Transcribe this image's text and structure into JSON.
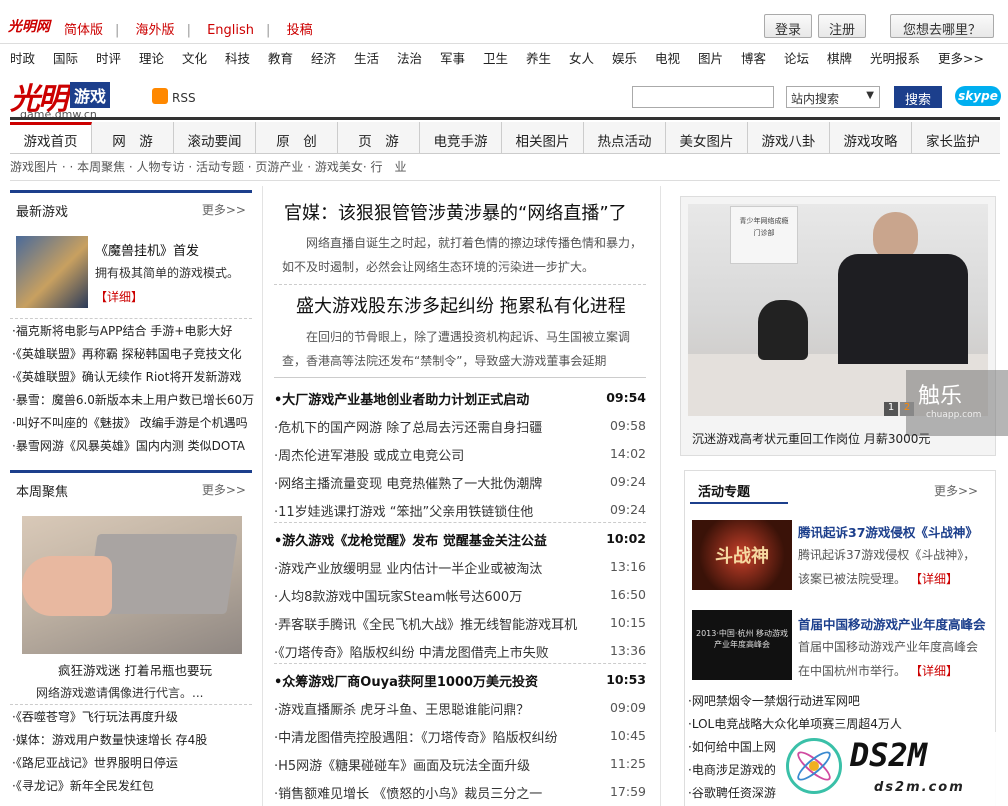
{
  "top": {
    "logo": "光明网",
    "links": [
      "简体版",
      "海外版",
      "English",
      "投稿"
    ],
    "login": "登录",
    "register": "注册",
    "where": "您想去哪里？"
  },
  "nav": [
    "时政",
    "国际",
    "时评",
    "理论",
    "文化",
    "科技",
    "教育",
    "经济",
    "生活",
    "法治",
    "军事",
    "卫生",
    "养生",
    "女人",
    "娱乐",
    "电视",
    "图片",
    "博客",
    "论坛",
    "棋牌",
    "光明报系",
    "更多>>"
  ],
  "brand": {
    "mark": "光明",
    "box": "游戏",
    "url": "game.gmw.cn",
    "rss": "RSS"
  },
  "search": {
    "select": "站内搜索",
    "button": "搜索",
    "skype": "skype"
  },
  "channels": [
    "游戏首页",
    "网　游",
    "滚动要闻",
    "原　创",
    "页　游",
    "电竞手游",
    "相关图片",
    "热点活动",
    "美女图片",
    "游戏八卦",
    "游戏攻略",
    "家长监护"
  ],
  "subnav": "游戏图片 · · 本周聚焦 · 人物专访 · 活动专题 · 页游产业 · 游戏美女· 行　业",
  "left": {
    "latest": {
      "title": "最新游戏",
      "more": "更多>>",
      "feature_title": "《魔兽挂机》首发",
      "feature_desc": "拥有极其简单的游戏模式。",
      "feature_link": "【详细】",
      "items": [
        "·福克斯将电影与APP结合 手游+电影大好",
        "·《英雄联盟》再称霸 探秘韩国电子竞技文化",
        "·《英雄联盟》确认无续作 Riot将开发新游戏",
        "·暴雪：魔兽6.0新版本未上用户数已增长60万",
        "·叫好不叫座的《魅拔》 改编手游是个机遇吗",
        "·暴雪网游《风暴英雄》国内内测 类似DOTA"
      ]
    },
    "weekly": {
      "title": "本周聚焦",
      "more": "更多>>",
      "cap1": "疯狂游戏迷 打着吊瓶也要玩",
      "cap2": "网络游戏邀请偶像进行代言。...",
      "items": [
        "·《吞噬苍穹》飞行玩法再度升级",
        "·媒体：游戏用户数量快速增长 存4股",
        "·《路尼亚战记》世界服明日停运",
        "·《寻龙记》新年全民发红包"
      ]
    }
  },
  "center": {
    "h1": "官媒：该狠狠管管涉黄涉暴的“网络直播”了",
    "p1a": "网络直播自诞生之时起，就打着色情的擦边球传播色情和暴力，",
    "p1b": "如不及时遏制，必然会让网络生态环境的污染进一步扩大。",
    "h2": "盛大游戏股东涉多起纠纷 拖累私有化进程",
    "p2a": "在回归的节骨眼上，除了遭遇投资机构起诉、马生国被立案调",
    "p2b": "查，香港高等法院还发布“禁制令”，导致盛大游戏董事会延期",
    "news": [
      {
        "t": "•大厂游戏产业基地创业者助力计划正式启动",
        "time": "09:54",
        "b": true
      },
      {
        "t": "·危机下的国产网游 除了总局去污还需自身扫疆",
        "time": "09:58",
        "b": false
      },
      {
        "t": "·周杰伦进军港股 或成立电竞公司",
        "time": "14:02",
        "b": false
      },
      {
        "t": "·网络主播流量变现 电竞热催熟了一大批伪潮牌",
        "time": "09:24",
        "b": false
      },
      {
        "t": "·11岁娃逃课打游戏 “笨拙”父亲用铁链锁住他",
        "time": "09:24",
        "b": false
      },
      {
        "t": "•游久游戏《龙枪觉醒》发布 觉醒基金关注公益",
        "time": "10:02",
        "b": true
      },
      {
        "t": "·游戏产业放缓明显 业内估计一半企业或被淘汰",
        "time": "13:16",
        "b": false
      },
      {
        "t": "·人均8款游戏中国玩家Steam帐号达600万",
        "time": "16:50",
        "b": false
      },
      {
        "t": "·弄客联手腾讯《全民飞机大战》推无线智能游戏耳机",
        "time": "10:15",
        "b": false
      },
      {
        "t": "·《刀塔传奇》陷版权纠纷 中清龙图借壳上市失败",
        "time": "13:36",
        "b": false
      },
      {
        "t": "•众筹游戏厂商Ouya获阿里1000万美元投资",
        "time": "10:53",
        "b": true
      },
      {
        "t": "·游戏直播厮杀 虎牙斗鱼、王思聪谁能问鼎？",
        "time": "09:09",
        "b": false
      },
      {
        "t": "·中清龙图借壳控股遇阻：《刀塔传奇》陷版权纠纷",
        "time": "10:45",
        "b": false
      },
      {
        "t": "·H5网游《糖果碰碰车》画面及玩法全面升级",
        "time": "11:25",
        "b": false
      },
      {
        "t": "·销售额难见增长 《愤怒的小鸟》裁员三分之一",
        "time": "17:59",
        "b": false
      }
    ]
  },
  "right": {
    "photo_caption": "沉迷游戏高考状元重回工作岗位 月薪3000元",
    "pager": [
      "1",
      "2"
    ],
    "watermark": "触乐",
    "watermark_url": "chuapp.com",
    "poster_lines": [
      "青少年网络成瘾",
      "门诊部"
    ],
    "topic": {
      "title": "活动专题",
      "more": "更多>>",
      "a_title": "腾讯起诉37游戏侵权《斗战神》",
      "a_desc1": "腾讯起诉37游戏侵权《斗战神》，",
      "a_desc2": "该案已被法院受理。",
      "a_link": "【详细】",
      "a_img": "斗战神",
      "b_title": "首届中国移动游戏产业年度高峰会",
      "b_desc1": "首届中国移动游戏产业年度高峰会",
      "b_desc2": "在中国杭州市举行。",
      "b_link": "【详细】",
      "b_img": "2013·中国·杭州 移动游戏产业年度高峰会",
      "items": [
        "·网吧禁烟令一禁烟行动进军网吧",
        "·LOL电竞战略大众化单项赛三周超4万人",
        "·如何给中国上网",
        "·电商涉足游戏的",
        "·谷歌聘任资深游"
      ]
    }
  },
  "overlay": {
    "brand": "DS2M",
    "url": "ds2m.com"
  }
}
